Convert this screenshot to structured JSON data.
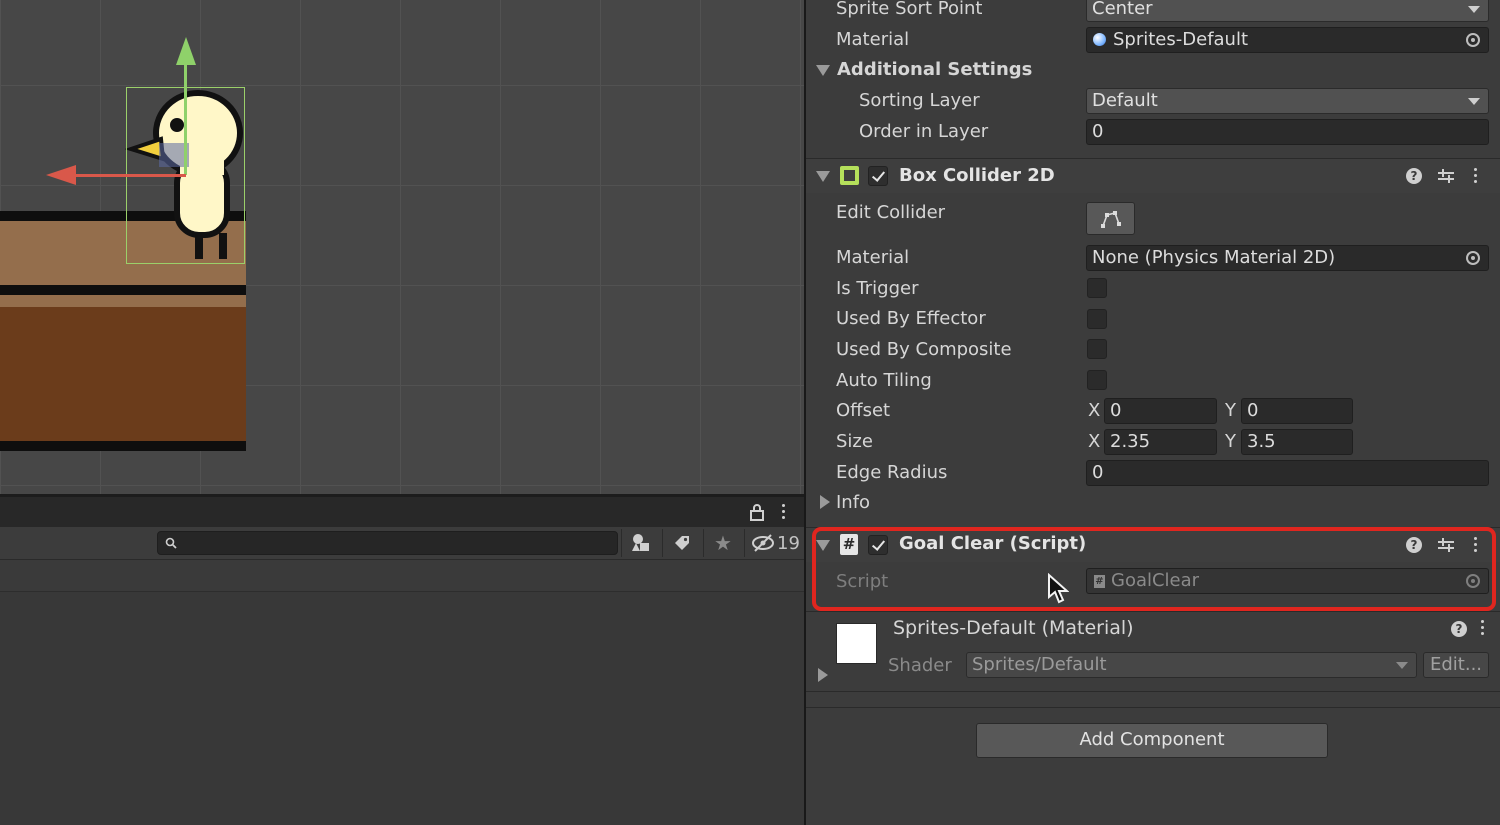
{
  "inspector": {
    "sprite_renderer": {
      "sprite_sort_point_label": "Sprite Sort Point",
      "sprite_sort_point_value": "Center",
      "material_label": "Material",
      "material_value": "Sprites-Default",
      "additional_settings_label": "Additional Settings",
      "sorting_layer_label": "Sorting Layer",
      "sorting_layer_value": "Default",
      "order_in_layer_label": "Order in Layer",
      "order_in_layer_value": "0"
    },
    "box_collider": {
      "title": "Box Collider 2D",
      "edit_collider_label": "Edit Collider",
      "material_label": "Material",
      "material_value": "None (Physics Material 2D)",
      "is_trigger_label": "Is Trigger",
      "used_by_effector_label": "Used By Effector",
      "used_by_composite_label": "Used By Composite",
      "auto_tiling_label": "Auto Tiling",
      "offset_label": "Offset",
      "offset_x": "0",
      "offset_y": "0",
      "size_label": "Size",
      "size_x": "2.35",
      "size_y": "3.5",
      "x_axis": "X",
      "y_axis": "Y",
      "edge_radius_label": "Edge Radius",
      "edge_radius_value": "0",
      "info_label": "Info"
    },
    "goal_clear": {
      "title": "Goal Clear (Script)",
      "script_label": "Script",
      "script_value": "GoalClear"
    },
    "material_preview": {
      "title": "Sprites-Default (Material)",
      "shader_label": "Shader",
      "shader_value": "Sprites/Default",
      "edit_label": "Edit..."
    },
    "add_component_label": "Add Component"
  },
  "project_panel": {
    "hidden_count": "19"
  },
  "colors": {
    "highlight": "#e0261f",
    "collider_icon": "#b5e05b",
    "y_gizmo": "#8fd16a",
    "x_gizmo": "#d9584a"
  }
}
